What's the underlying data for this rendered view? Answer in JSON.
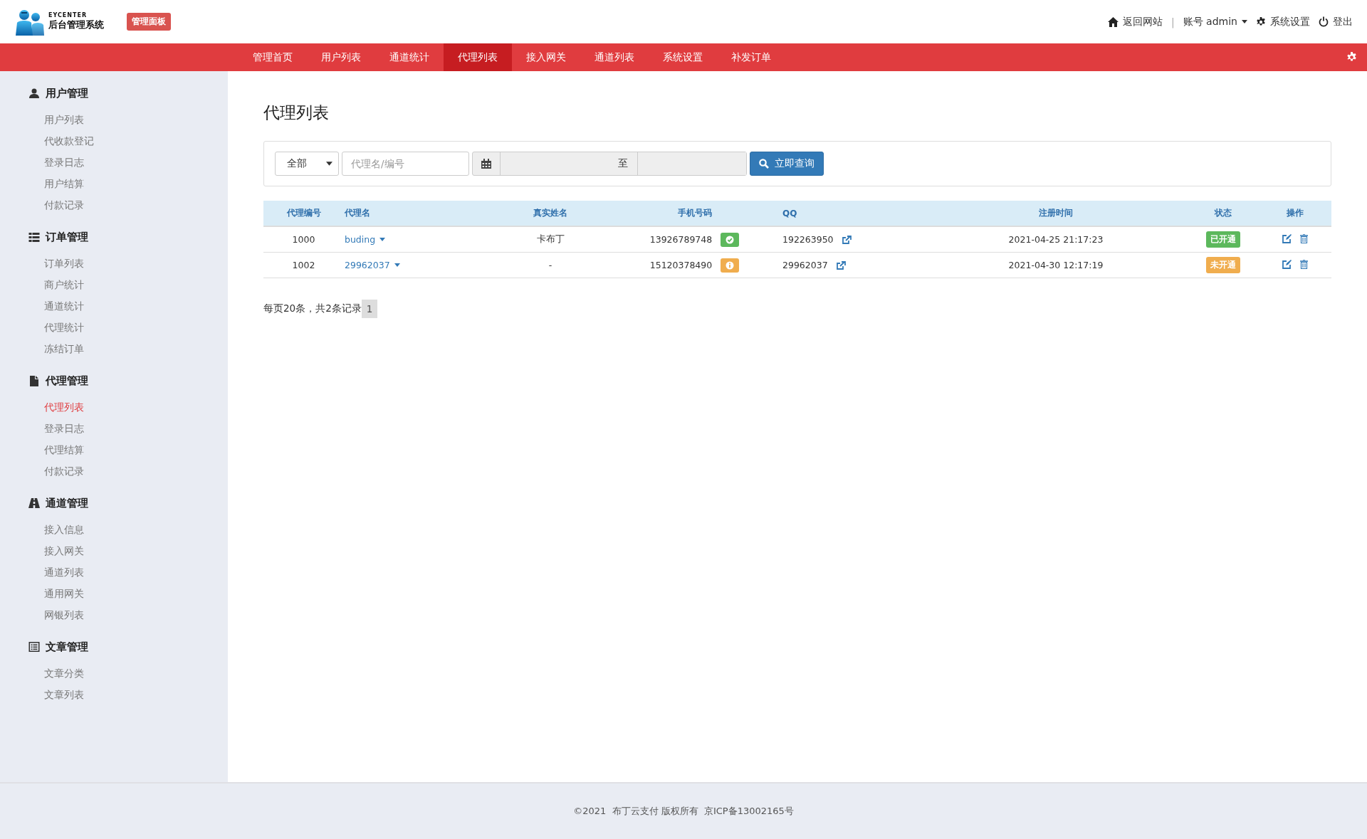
{
  "header": {
    "logo_small": "EYCENTER",
    "logo_title": "后台管理系统",
    "badge": "管理面板",
    "links": [
      {
        "kind": "home",
        "label": "返回网站"
      },
      {
        "kind": "separator",
        "label": "|"
      },
      {
        "kind": "account",
        "label": "账号 admin"
      },
      {
        "kind": "settings",
        "label": "系统设置"
      },
      {
        "kind": "logout",
        "label": "登出"
      }
    ]
  },
  "nav": {
    "items": [
      {
        "label": "管理首页",
        "selected": false
      },
      {
        "label": "用户列表",
        "selected": false
      },
      {
        "label": "通道统计",
        "selected": false
      },
      {
        "label": "代理列表",
        "selected": true
      },
      {
        "label": "接入网关",
        "selected": false
      },
      {
        "label": "通道列表",
        "selected": false
      },
      {
        "label": "系统设置",
        "selected": false
      },
      {
        "label": "补发订单",
        "selected": false
      }
    ]
  },
  "sidebar": {
    "groups": [
      {
        "title": "用户管理",
        "items": [
          {
            "label": "用户列表",
            "selected": false
          },
          {
            "label": "代收款登记",
            "selected": false
          },
          {
            "label": "登录日志",
            "selected": false
          },
          {
            "label": "用户结算",
            "selected": false
          },
          {
            "label": "付款记录",
            "selected": false
          }
        ]
      },
      {
        "title": "订单管理",
        "items": [
          {
            "label": "订单列表",
            "selected": false
          },
          {
            "label": "商户统计",
            "selected": false
          },
          {
            "label": "通道统计",
            "selected": false
          },
          {
            "label": "代理统计",
            "selected": false
          },
          {
            "label": "冻结订单",
            "selected": false
          }
        ]
      },
      {
        "title": "代理管理",
        "items": [
          {
            "label": "代理列表",
            "selected": true
          },
          {
            "label": "登录日志",
            "selected": false
          },
          {
            "label": "代理结算",
            "selected": false
          },
          {
            "label": "付款记录",
            "selected": false
          }
        ]
      },
      {
        "title": "通道管理",
        "items": [
          {
            "label": "接入信息",
            "selected": false
          },
          {
            "label": "接入网关",
            "selected": false
          },
          {
            "label": "通道列表",
            "selected": false
          },
          {
            "label": "通用网关",
            "selected": false
          },
          {
            "label": "网银列表",
            "selected": false
          }
        ]
      },
      {
        "title": "文章管理",
        "items": [
          {
            "label": "文章分类",
            "selected": false
          },
          {
            "label": "文章列表",
            "selected": false
          }
        ]
      }
    ]
  },
  "page": {
    "title": "代理列表",
    "filter": {
      "select_value": "全部",
      "search_placeholder": "代理名/编号",
      "range_separator": "至",
      "button": "立即查询"
    },
    "table": {
      "columns": [
        "代理编号",
        "代理名",
        "真实姓名",
        "手机号码",
        "QQ",
        "注册时间",
        "状态",
        "操作"
      ],
      "rows": [
        {
          "id": "1000",
          "name": "buding",
          "real_name": "卡布丁",
          "phone": "13926789748",
          "phone_verified": true,
          "qq": "192263950",
          "registered": "2021-04-25 21:17:23",
          "status": "已开通",
          "active": true
        },
        {
          "id": "1002",
          "name": "29962037",
          "real_name": "-",
          "phone": "15120378490",
          "phone_verified": false,
          "qq": "29962037",
          "registered": "2021-04-30 12:17:19",
          "status": "未开通",
          "active": false
        }
      ]
    },
    "pager": {
      "summary": "每页20条，共2条记录",
      "pages": [
        {
          "label": "1",
          "selected": true
        }
      ]
    }
  },
  "footer": "©2021  布丁云支付 版权所有  京ICP备13002165号"
}
